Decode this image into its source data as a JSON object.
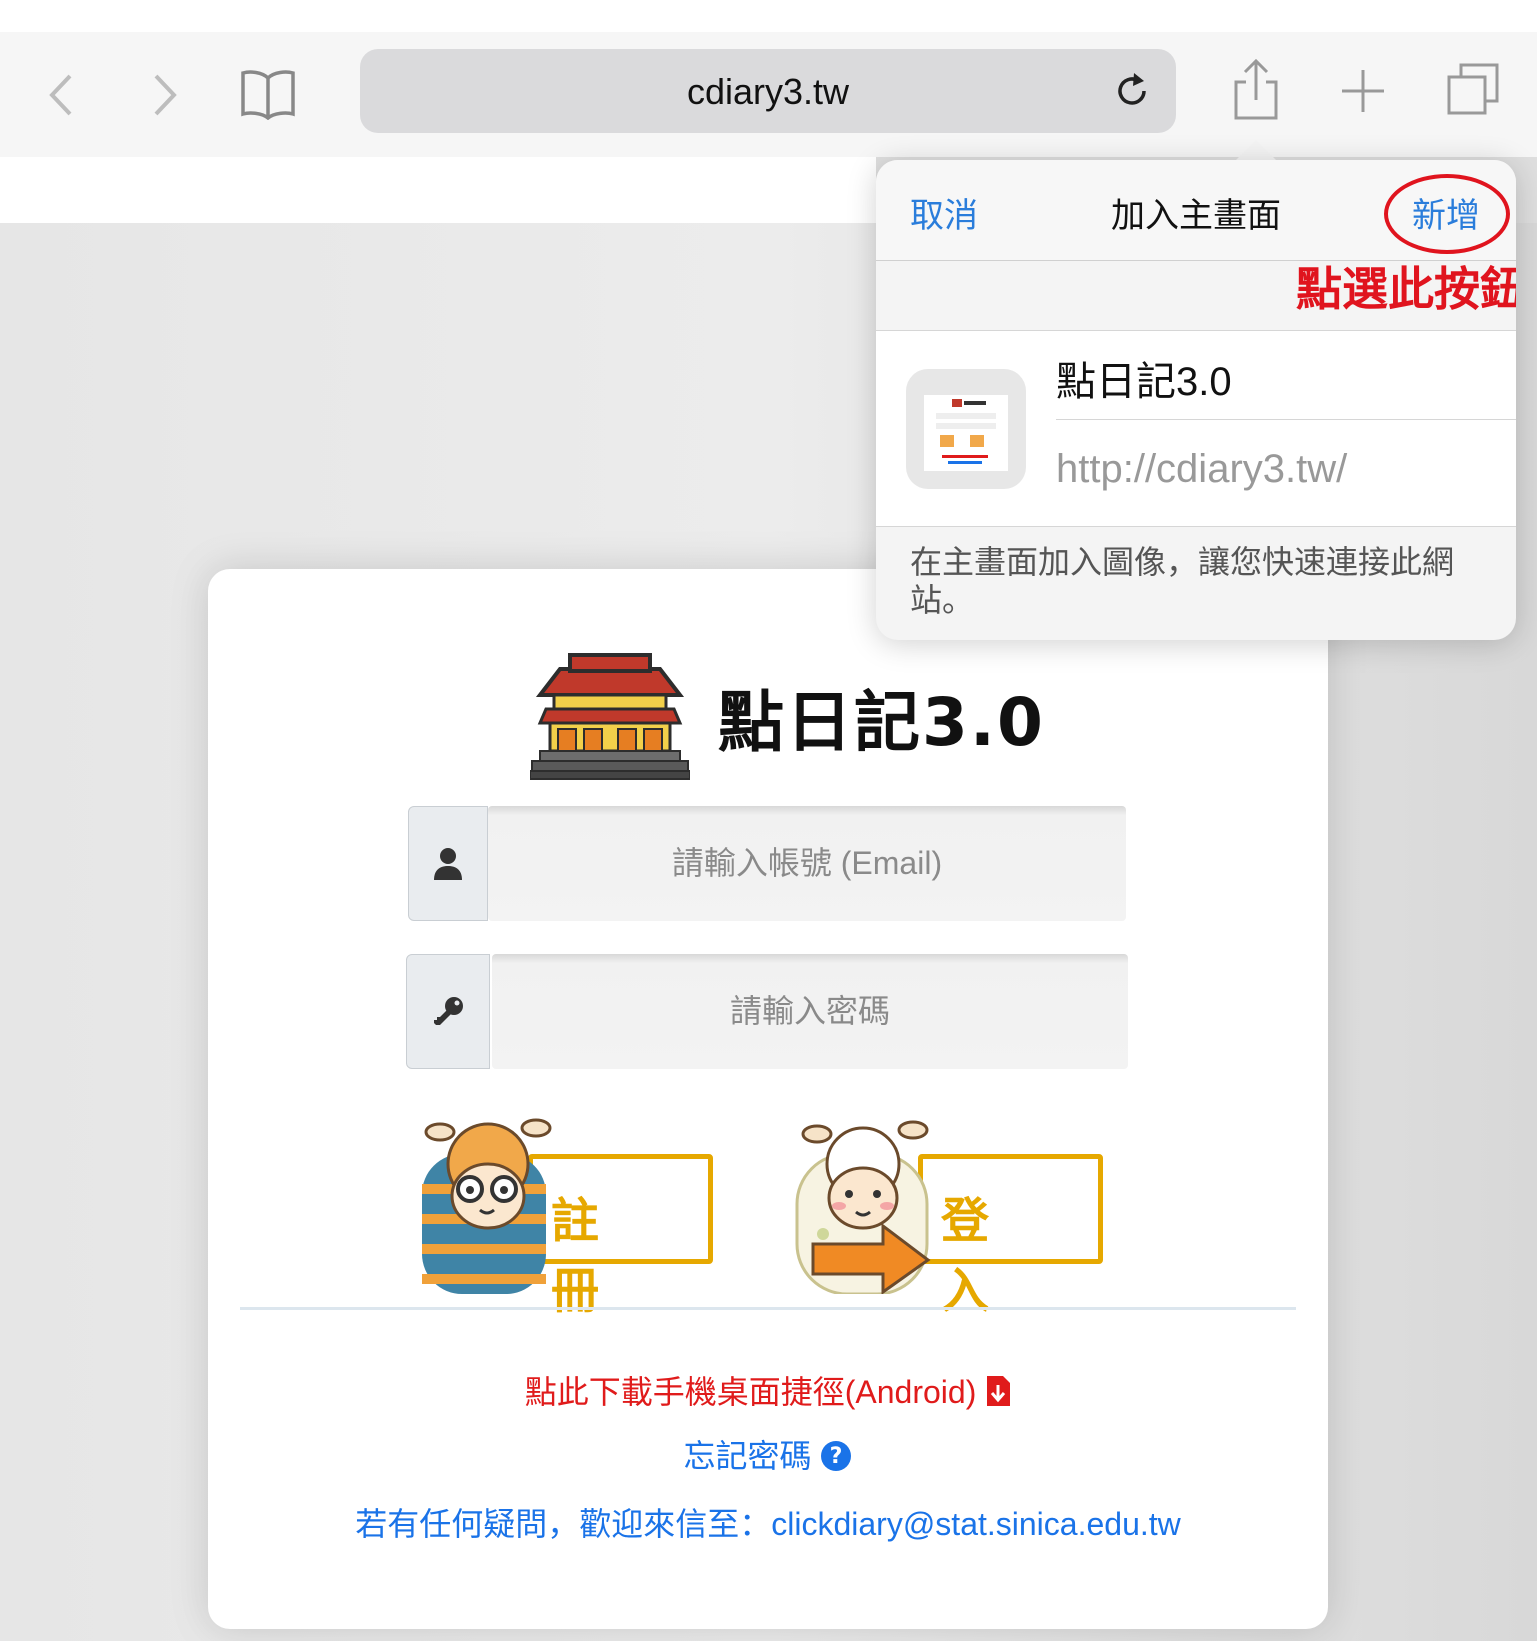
{
  "browser": {
    "url": "cdiary3.tw"
  },
  "popover": {
    "cancel_label": "取消",
    "title": "加入主畫面",
    "add_label": "新增",
    "annotation": "點選此按鈕",
    "app_name": "點日記3.0",
    "app_url": "http://cdiary3.tw/",
    "description": "在主畫面加入圖像，讓您快速連接此網站。"
  },
  "login": {
    "site_title": "點日記3.0",
    "email_placeholder": "請輸入帳號 (Email)",
    "password_placeholder": "請輸入密碼",
    "register_label": "註冊",
    "login_label": "登入",
    "download_link": "點此下載手機桌面捷徑(Android)",
    "forgot_link": "忘記密碼",
    "contact_text": "若有任何疑問，歡迎來信至：clickdiary@stat.sinica.edu.tw"
  },
  "colors": {
    "ios_blue": "#2a7ddb",
    "annotation_red": "#e0141e",
    "button_gold": "#e6a800",
    "link_blue": "#1a73e8",
    "download_red": "#e01b1b"
  },
  "icons": [
    "back-icon",
    "forward-icon",
    "bookmarks-icon",
    "reload-icon",
    "share-icon",
    "new-tab-icon",
    "tabs-icon",
    "user-icon",
    "key-icon",
    "pdf-download-icon",
    "question-circle-icon"
  ]
}
